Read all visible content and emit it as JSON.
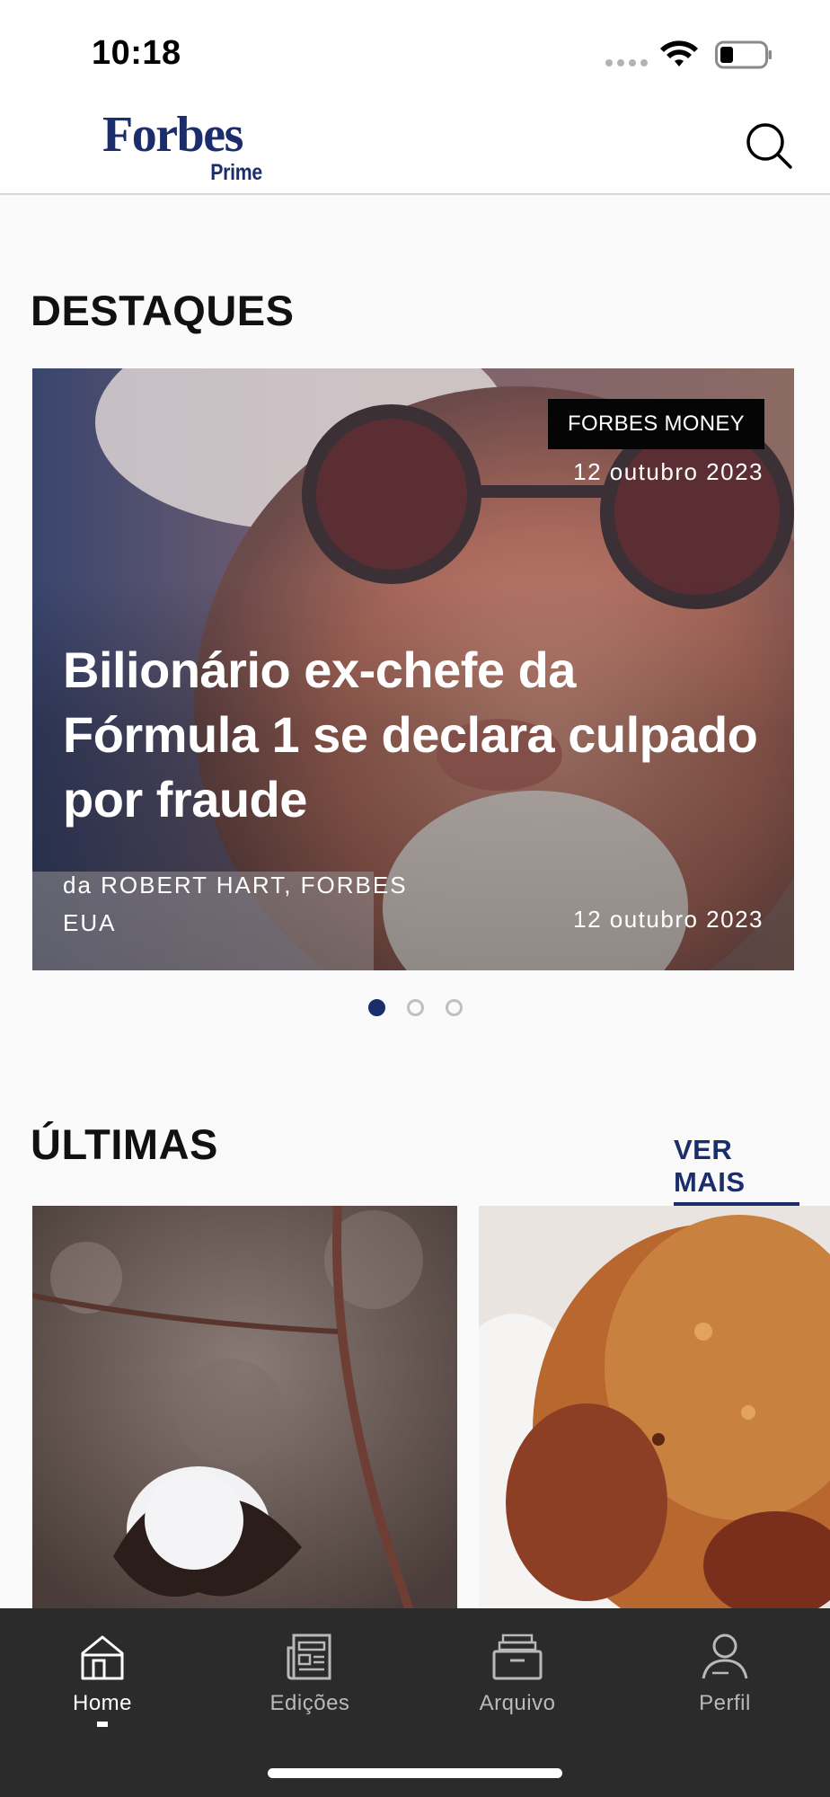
{
  "status_bar": {
    "time": "10:18"
  },
  "header": {
    "logo": {
      "main": "Forbes",
      "sub": "Prime"
    },
    "search_icon": "search-icon"
  },
  "highlights": {
    "title": "DESTAQUES",
    "card": {
      "category": "FORBES MONEY",
      "date_top": "12 outubro 2023",
      "headline": "Bilionário ex-chefe da Fórmula 1 se declara culpado por fraude",
      "author": "da ROBERT HART, FORBES EUA",
      "date_bottom": "12 outubro 2023"
    },
    "pager": {
      "total": 3,
      "active_index": 0
    }
  },
  "latest": {
    "title": "ÚLTIMAS",
    "see_more": "VER MAIS"
  },
  "tab_bar": {
    "items": [
      {
        "label": "Home",
        "icon": "home-icon",
        "active": true
      },
      {
        "label": "Edições",
        "icon": "newspaper-icon",
        "active": false
      },
      {
        "label": "Arquivo",
        "icon": "archive-box-icon",
        "active": false
      },
      {
        "label": "Perfil",
        "icon": "user-icon",
        "active": false
      }
    ]
  },
  "colors": {
    "brand_navy": "#1b2d6b",
    "tab_bar_bg": "#2b2b2b",
    "tag_bg": "#050505"
  }
}
